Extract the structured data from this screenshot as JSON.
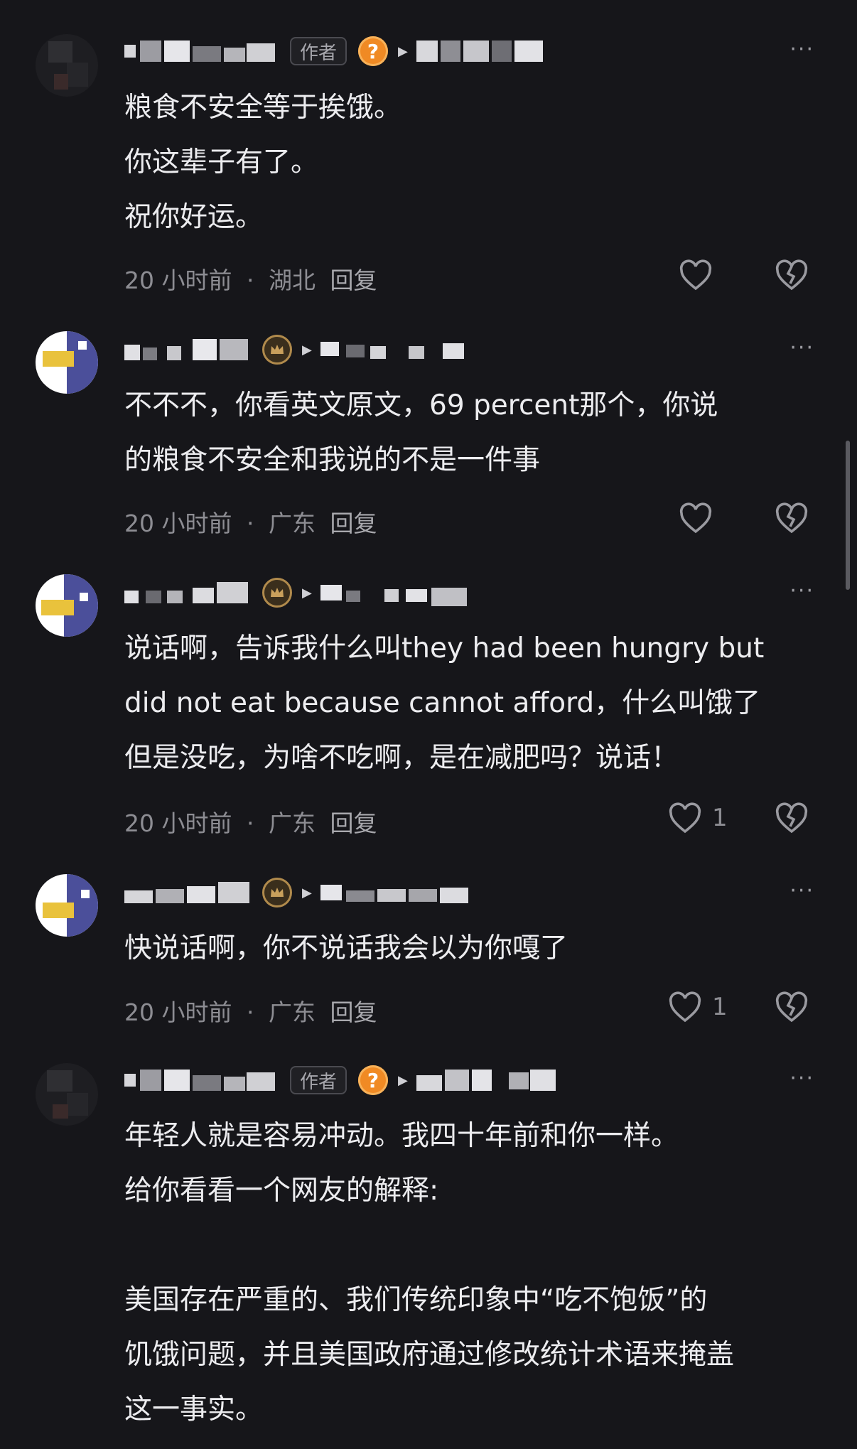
{
  "comments": [
    {
      "role": "author",
      "author_tag": "作者",
      "badge": "question-badge",
      "lines": [
        "粮食不安全等于挨饿。",
        "你这辈子有了。",
        "祝你好运。"
      ],
      "time": "20 小时前",
      "location": "湖北",
      "reply": "回复",
      "likes": ""
    },
    {
      "role": "user",
      "badge": "crown-badge",
      "lines": [
        "不不不，你看英文原文，69 percent那个，你说",
        "的粮食不安全和我说的不是一件事"
      ],
      "time": "20 小时前",
      "location": "广东",
      "reply": "回复",
      "likes": ""
    },
    {
      "role": "user",
      "badge": "crown-badge",
      "lines": [
        "说话啊，告诉我什么叫they had been hungry but",
        "did not eat because cannot afford，什么叫饿了",
        "但是没吃，为啥不吃啊，是在减肥吗？说话！"
      ],
      "time": "20 小时前",
      "location": "广东",
      "reply": "回复",
      "likes": "1"
    },
    {
      "role": "user",
      "badge": "crown-badge",
      "lines": [
        "快说话啊，你不说话我会以为你嘎了"
      ],
      "time": "20 小时前",
      "location": "广东",
      "reply": "回复",
      "likes": "1"
    },
    {
      "role": "author",
      "author_tag": "作者",
      "badge": "question-badge",
      "lines": [
        "年轻人就是容易冲动。我四十年前和你一样。",
        "给你看看一个网友的解释:",
        "",
        "美国存在严重的、我们传统印象中“吃不饱饭”的",
        "饥饿问题，并且美国政府通过修改统计术语来掩盖",
        "这一事实。"
      ],
      "time": "",
      "location": "",
      "reply": "",
      "likes": ""
    }
  ],
  "ui": {
    "separator": "·",
    "more": "···"
  },
  "colors": {
    "background": "#16161a",
    "text": "#ececef",
    "meta": "#8d8d93",
    "badge_orange": "#f08a24",
    "crown_gold": "#b08a4c"
  }
}
